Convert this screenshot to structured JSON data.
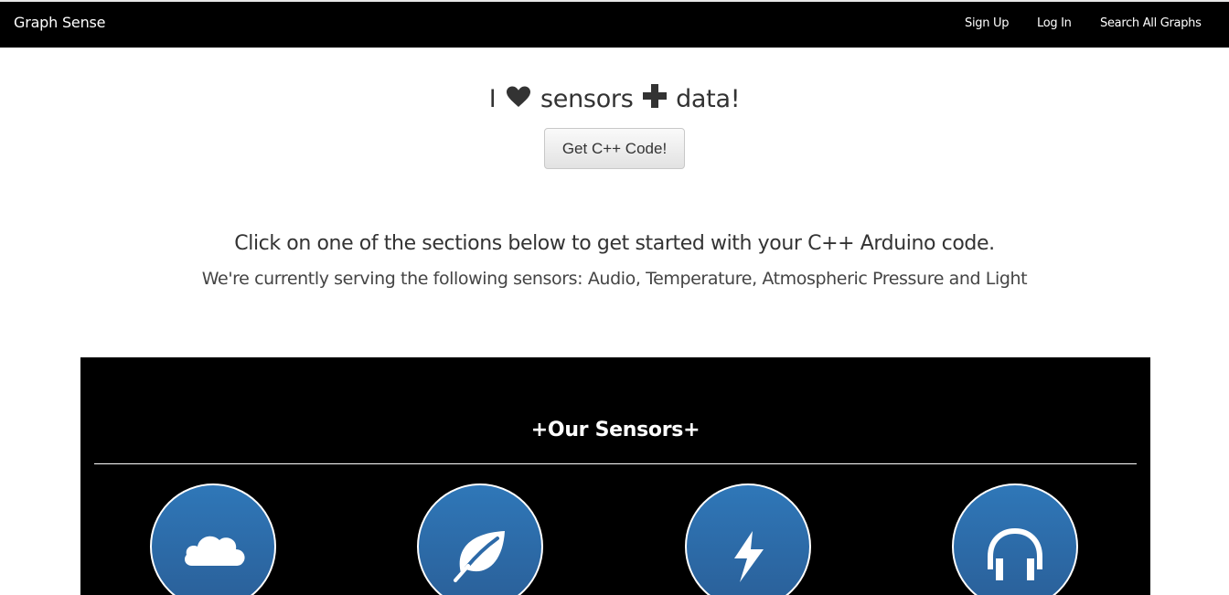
{
  "navbar": {
    "brand": "Graph Sense",
    "links": [
      {
        "label": "Sign Up"
      },
      {
        "label": "Log In"
      },
      {
        "label": "Search All Graphs"
      }
    ]
  },
  "hero": {
    "word_i": "I",
    "word_sensors": "sensors",
    "word_data": "data!",
    "heart_icon": "heart-icon",
    "plus_icon": "plus-icon",
    "button_label": "Get C++ Code!"
  },
  "intro": {
    "heading": "Click on one of the sections below to get started with your C++ Arduino code.",
    "subheading": "We're currently serving the following sensors: Audio, Temperature, Atmospheric Pressure and Light"
  },
  "sensors": {
    "title": "+Our Sensors+",
    "items": [
      {
        "icon": "cloud-icon"
      },
      {
        "icon": "leaf-icon"
      },
      {
        "icon": "lightning-icon"
      },
      {
        "icon": "headphones-icon"
      }
    ]
  },
  "colors": {
    "navbar_bg": "#000000",
    "panel_bg": "#000000",
    "circle_blue": "#2f6faf",
    "text": "#333333"
  }
}
